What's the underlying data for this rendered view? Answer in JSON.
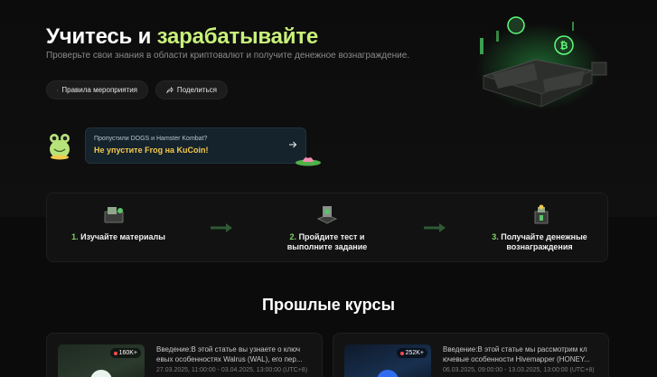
{
  "hero": {
    "title_part1": "Учитесь и ",
    "title_part2": "зарабатывайте",
    "subtitle": "Проверьте свои знания в области криптовалют и получите денежное вознаграждение.",
    "rules_button": "Правила мероприятия",
    "share_button": "Поделиться",
    "accent_color": "#c8f07a"
  },
  "promo": {
    "small_text": "Пропустили DOGS и Hamster Kombat?",
    "main_text": "Не упустите Frog на KuCoin!",
    "main_color": "#f5c84b"
  },
  "steps": [
    {
      "num": "1.",
      "line1": "Изучайте материалы",
      "line2": ""
    },
    {
      "num": "2.",
      "line1": "Пройдите тест и",
      "line2": "выполните задание"
    },
    {
      "num": "3.",
      "line1": "Получайте денежные",
      "line2": "вознаграждения"
    }
  ],
  "past_courses": {
    "title": "Прошлые курсы",
    "cards": [
      {
        "views": "160K+",
        "logo": "W",
        "desc_line1": "Введение:В этой статье вы узнаете о ключ",
        "desc_line2": "евых особенностях Walrus (WAL), его пер...",
        "date": "27.03.2025, 11:00:00 - 03.04.2025, 13:00:00 (UTC+8)"
      },
      {
        "views": "252K+",
        "logo": "H",
        "desc_line1": "Введение:В этой статье мы рассмотрим кл",
        "desc_line2": "ючевые особенности Hivemapper (HONEY...",
        "date": "06.03.2025, 09:00:00 - 13.03.2025, 13:00:00 (UTC+8)"
      }
    ]
  }
}
